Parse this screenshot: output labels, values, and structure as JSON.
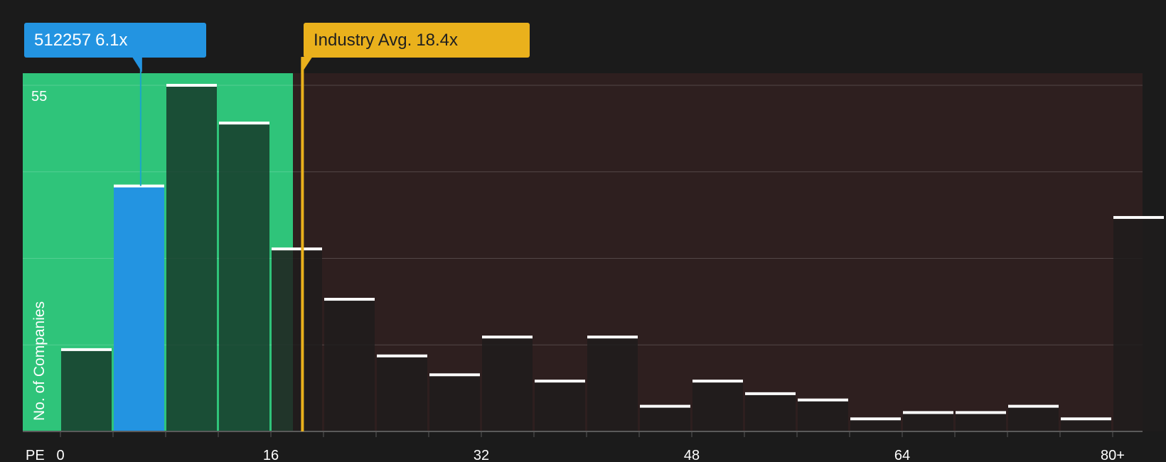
{
  "callouts": {
    "company": {
      "ticker": "512257",
      "value_label": "6.1x",
      "pe": 6.1,
      "color": "#2394e1"
    },
    "industry": {
      "label": "Industry Avg.",
      "value_label": "18.4x",
      "pe": 18.4,
      "color": "#eab11c"
    }
  },
  "chart_data": {
    "type": "bar",
    "xlabel": "PE",
    "ylabel": "No. of Companies",
    "x_ticks": [
      "0",
      "16",
      "32",
      "48",
      "64",
      "80+"
    ],
    "x_tick_values": [
      0,
      16,
      32,
      48,
      64,
      80
    ],
    "y_tick_labels": [
      "55"
    ],
    "ylim": [
      0,
      55
    ],
    "xlim": [
      0,
      82
    ],
    "bin_width": 4,
    "bins_start": [
      0,
      4,
      8,
      12,
      16,
      20,
      24,
      28,
      32,
      36,
      40,
      44,
      48,
      52,
      56,
      60,
      64,
      68,
      72,
      76,
      80
    ],
    "values": [
      13,
      39,
      55,
      49,
      29,
      21,
      12,
      9,
      15,
      8,
      15,
      4,
      8,
      6,
      5,
      2,
      3,
      3,
      4,
      2,
      34
    ],
    "highlight_bin_index": 1,
    "zones": {
      "below_industry_color": "#2fc47a",
      "above_industry_color": "#2e1f1f"
    },
    "grid": true
  }
}
